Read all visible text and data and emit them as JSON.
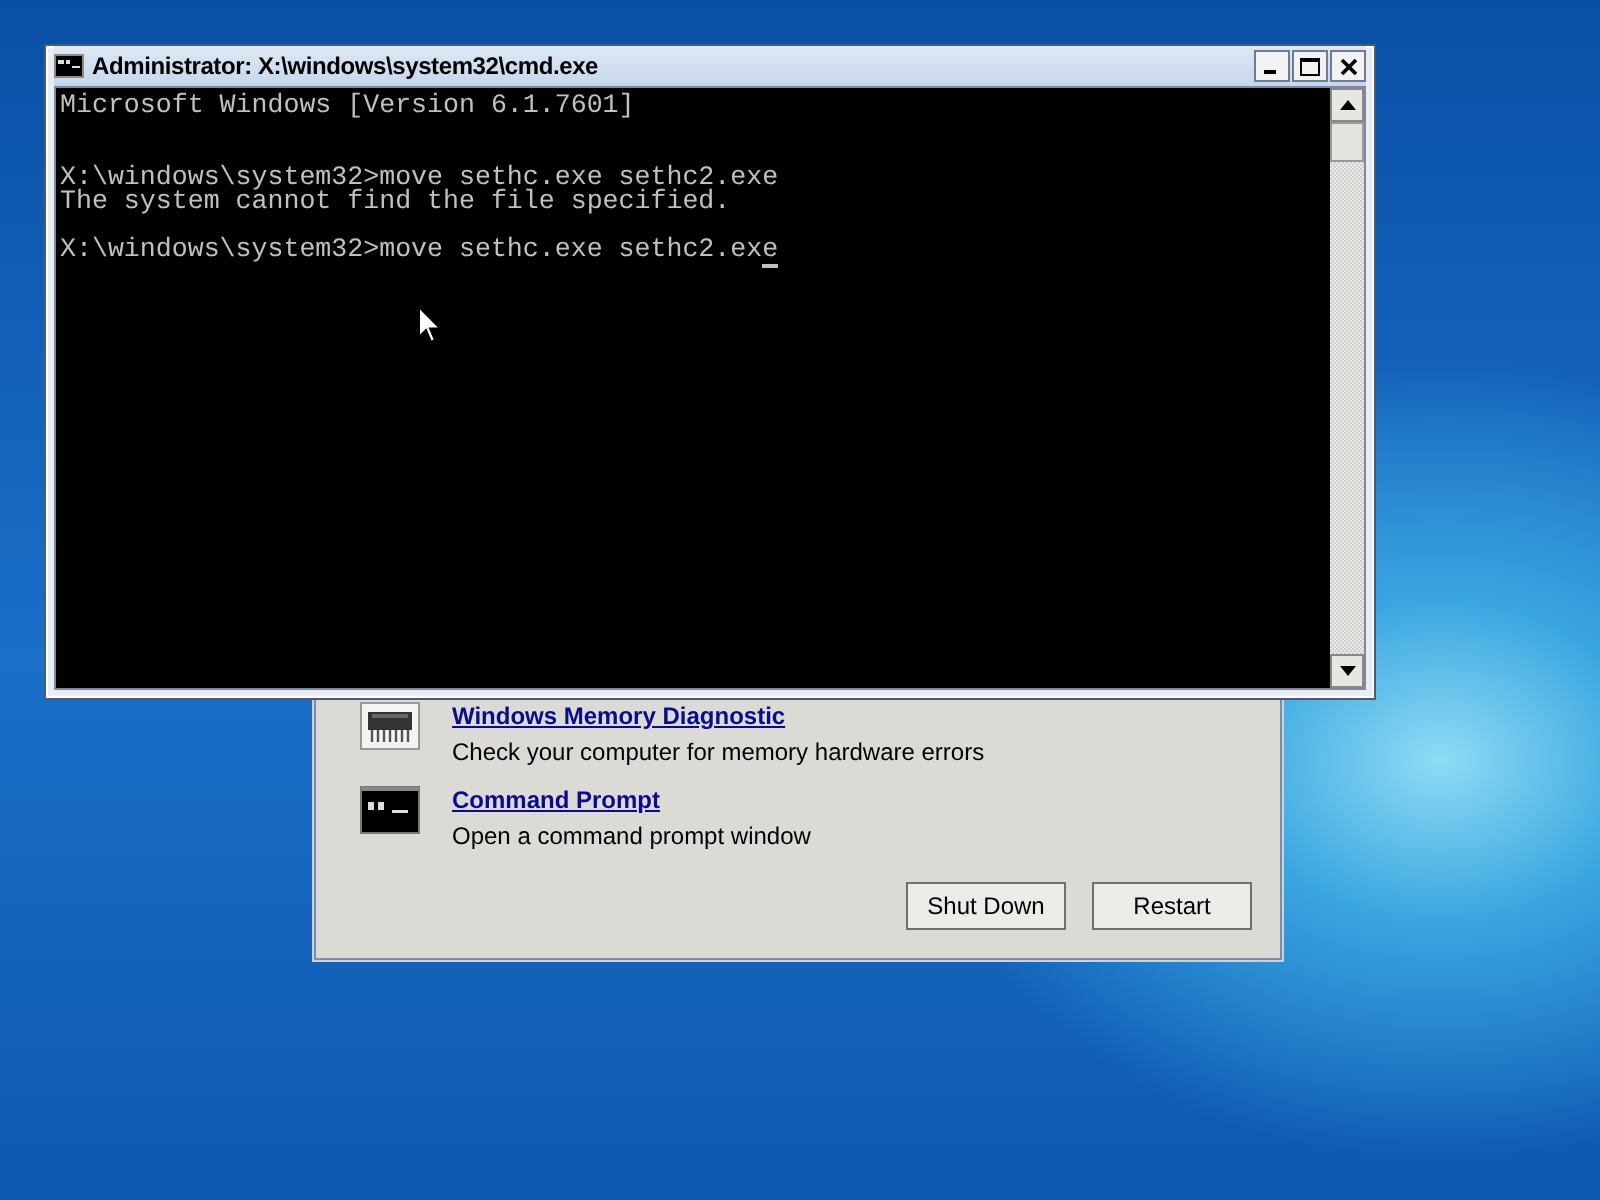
{
  "console_window": {
    "title": "Administrator: X:\\windows\\system32\\cmd.exe",
    "cursor_visible": true,
    "lines": [
      {
        "kind": "banner",
        "text": "Microsoft Windows [Version 6.1.7601]"
      },
      {
        "kind": "prompt",
        "text": "X:\\windows\\system32>move sethc.exe sethc2.exe"
      },
      {
        "kind": "output",
        "text": "The system cannot find the file specified."
      },
      {
        "kind": "prompt",
        "text": "X:\\windows\\system32>move sethc.exe sethc2.exe"
      }
    ]
  },
  "recovery_dialog": {
    "tools": [
      {
        "kind": "memory",
        "title": "Windows Memory Diagnostic",
        "description": "Check your computer for memory hardware errors"
      },
      {
        "kind": "console",
        "title": "Command Prompt",
        "description": "Open a command prompt window"
      }
    ],
    "buttons": [
      "Shut Down",
      "Restart"
    ]
  }
}
